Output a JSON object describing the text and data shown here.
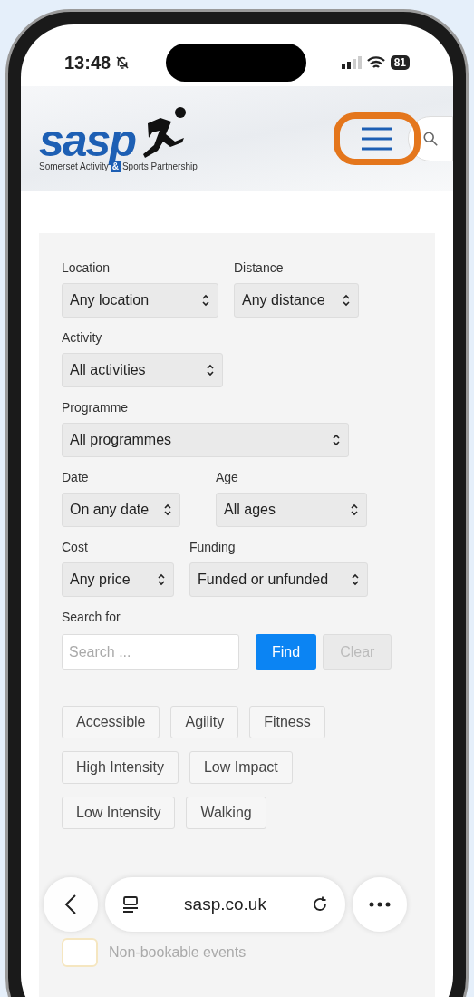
{
  "status_bar": {
    "time": "13:48",
    "battery": "81"
  },
  "header": {
    "logo": "sasp",
    "tagline": [
      "Somerset Activity",
      "&",
      "Sports Partnership"
    ],
    "menu_highlighted": true
  },
  "filters": [
    [
      {
        "label": "Location",
        "value": "Any location"
      },
      {
        "label": "Distance",
        "value": "Any distance"
      }
    ],
    [
      {
        "label": "Activity",
        "value": "All activities"
      }
    ],
    [
      {
        "label": "Programme",
        "value": "All programmes"
      }
    ],
    [
      {
        "label": "Date",
        "value": "On any date"
      },
      {
        "label": "Age",
        "value": "All ages"
      }
    ],
    [
      {
        "label": "Cost",
        "value": "Any price"
      },
      {
        "label": "Funding",
        "value": "Funded or unfunded"
      }
    ]
  ],
  "search": {
    "label": "Search for",
    "placeholder": "Search ...",
    "buttons": [
      {
        "label": "Find",
        "disabled": false
      },
      {
        "label": "Clear",
        "disabled": true
      }
    ]
  },
  "tags": [
    "Accessible",
    "Agility",
    "Fitness",
    "High Intensity",
    "Low Impact",
    "Low Intensity",
    "Walking"
  ],
  "legend": [
    {
      "label": "Non-bookable events"
    }
  ],
  "browser": {
    "url": "sasp.co.uk"
  }
}
